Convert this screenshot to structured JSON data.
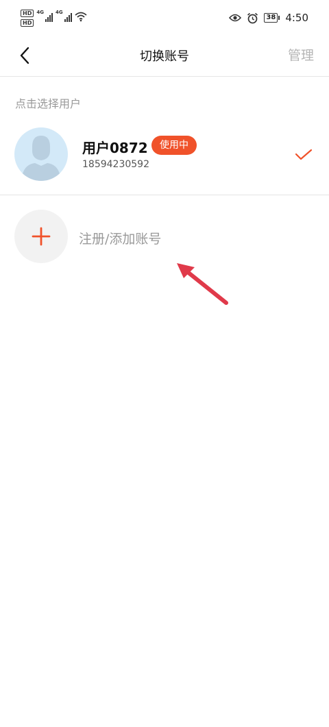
{
  "status_bar": {
    "hd_badges": [
      "HD",
      "HD"
    ],
    "net1": "4G",
    "net2": "4G",
    "battery": "38",
    "time": "4:50"
  },
  "nav": {
    "title": "切换账号",
    "manage_label": "管理"
  },
  "section_label": "点击选择用户",
  "account": {
    "name": "用户0872",
    "badge": "使用中",
    "phone": "18594230592",
    "selected": true
  },
  "add_account": {
    "label": "注册/添加账号"
  },
  "colors": {
    "accent": "#f0522a",
    "arrow": "#e03a4a",
    "avatar_bg": "#d3e9f8"
  },
  "icons": {
    "back": "chevron-left-icon",
    "check": "check-icon",
    "add": "plus-icon",
    "eye": "eye-icon",
    "alarm": "alarm-icon",
    "wifi": "wifi-icon"
  }
}
